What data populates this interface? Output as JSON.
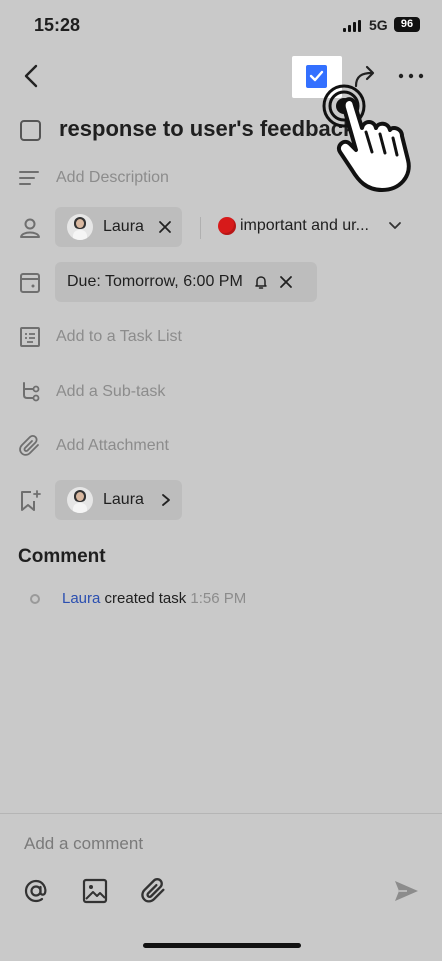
{
  "status_bar": {
    "time": "15:28",
    "network": "5G",
    "battery": "96"
  },
  "task": {
    "title": "response to user's feedback",
    "description_placeholder": "Add Description",
    "assignee": "Laura",
    "priority": "important and ur...",
    "due": "Due: Tomorrow, 6:00 PM",
    "task_list_placeholder": "Add to a Task List",
    "subtask_placeholder": "Add a Sub-task",
    "attachment_placeholder": "Add Attachment",
    "follower": "Laura"
  },
  "comments": {
    "heading": "Comment",
    "activity": {
      "user": "Laura",
      "action": " created task ",
      "time": "1:56 PM"
    },
    "input_placeholder": "Add a comment"
  },
  "colors": {
    "accent": "#3370ff",
    "priority": "#d71a1a",
    "link": "#2b4fb0"
  },
  "icons": [
    "back-icon",
    "bookmark-check-icon",
    "share-icon",
    "more-icon",
    "description-icon",
    "person-icon",
    "calendar-icon",
    "bell-icon",
    "close-icon",
    "task-list-icon",
    "subtask-icon",
    "paperclip-icon",
    "bookmark-add-icon",
    "chevron-right-icon",
    "chevron-down-icon",
    "at-icon",
    "image-icon",
    "send-icon",
    "tap-hand-icon"
  ]
}
